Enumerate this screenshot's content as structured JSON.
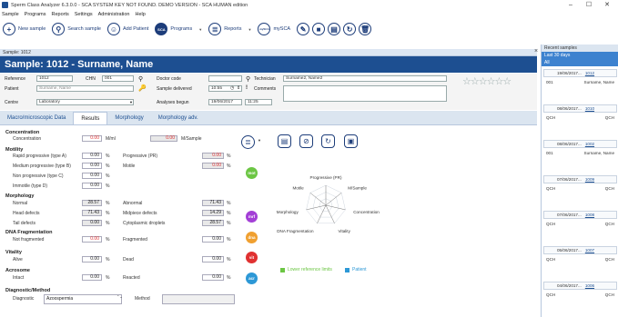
{
  "window": {
    "title": "Sperm Class Analyzer 6.3.0.0 - SCA SYSTEM KEY NOT FOUND. DEMO VERSION - SCA HUMAN edition",
    "minimize": "–",
    "maximize": "☐",
    "close": "✕"
  },
  "menu": [
    "Sample",
    "Programs",
    "Reports",
    "Settings",
    "Administration",
    "Help"
  ],
  "toolbar": {
    "new_sample": "New sample",
    "search_sample": "Search sample",
    "add_patient": "Add Patient",
    "programs": "Programs",
    "reports": "Reports",
    "mysca": "mySCA",
    "sca_badge": "SCA",
    "mysca_badge": "mySCA"
  },
  "sample_tab": "Sample: 1012",
  "header": {
    "title": "Sample: 1012 - Surname, Name"
  },
  "form": {
    "reference_label": "Reference",
    "reference_value": "1012",
    "chn_label": "CHN",
    "chn_value": "001",
    "doctor_label": "Doctor code",
    "doctor_value": "",
    "technician_label": "Technician",
    "technician_value": "Surname2, Name2",
    "patient_label": "Patient",
    "patient_value": "Surname, Name",
    "delivered_label": "Sample delivered",
    "delivered_value": "10:55",
    "comments_label": "Comments",
    "centre_label": "Centre",
    "centre_value": "Laboratory",
    "analyses_label": "Analyses begun",
    "analyses_date": "19/06/2017",
    "analyses_time": "11:25"
  },
  "rating_stars": 0,
  "tabs": [
    "Macro/microscopic Data",
    "Results",
    "Morphology",
    "Morphology adv."
  ],
  "active_tab": "Results",
  "results": {
    "concentration": {
      "title": "Concentration",
      "label": "Concentration",
      "value": "0.00",
      "unit": "M/ml",
      "value2": "0.00",
      "unit2": "M/Sample"
    },
    "motility": {
      "title": "Motility",
      "rows": [
        {
          "label": "Rapid progressive (type A)",
          "value": "0.00",
          "unit": "%"
        },
        {
          "label": "Medium progressive (type B)",
          "value": "0.00",
          "unit": "%"
        },
        {
          "label": "Non progressive (type C)",
          "value": "0.00",
          "unit": "%"
        },
        {
          "label": "Immotile (type D)",
          "value": "0.00",
          "unit": "%"
        }
      ],
      "rows2": [
        {
          "label": "Progressive (PR)",
          "value": "0.00",
          "unit": "%"
        },
        {
          "label": "Motile",
          "value": "0.00",
          "unit": "%"
        }
      ]
    },
    "morphology": {
      "title": "Morphology",
      "rows": [
        {
          "label": "Normal",
          "value": "28.57",
          "unit": "%"
        },
        {
          "label": "Head defects",
          "value": "71.43",
          "unit": "%"
        },
        {
          "label": "Tail defects",
          "value": "0.00",
          "unit": "%"
        }
      ],
      "rows2": [
        {
          "label": "Abnormal",
          "value": "71.43",
          "unit": "%"
        },
        {
          "label": "Midpiece defects",
          "value": "14.29",
          "unit": "%"
        },
        {
          "label": "Cytoplasmic droplets",
          "value": "28.57",
          "unit": "%"
        }
      ]
    },
    "dna": {
      "title": "DNA Fragmentation",
      "label": "Not fragmented",
      "value": "0.00",
      "unit": "%",
      "label2": "Fragmented",
      "value2": "0.00",
      "unit2": "%"
    },
    "vitality": {
      "title": "Vitality",
      "label": "Alive",
      "value": "0.00",
      "unit": "%",
      "label2": "Dead",
      "value2": "0.00",
      "unit2": "%"
    },
    "acrosome": {
      "title": "Acrosome",
      "label": "Intact",
      "value": "0.00",
      "unit": "%",
      "label2": "Reacted",
      "value2": "0.00",
      "unit2": "%"
    },
    "diagnostic": {
      "title": "Diagnostic/Method",
      "label": "Diagnostic",
      "value": "Azoospermia",
      "method_label": "Method"
    }
  },
  "badges": [
    {
      "label": "mot",
      "color": "#6cc644"
    },
    {
      "label": "mrf",
      "color": "#a33fd6"
    },
    {
      "label": "dna",
      "color": "#f0a030"
    },
    {
      "label": "vit",
      "color": "#e03131"
    },
    {
      "label": "acr",
      "color": "#2d98d6"
    }
  ],
  "radar": {
    "labels": [
      "Progressive (PR)",
      "M/Sample",
      "Concentration",
      "Vitality",
      "DNA Fragmentation",
      "Morphology",
      "Motile"
    ],
    "legend_lower": "Lower reference limits",
    "legend_patient": "Patient",
    "lower_color": "#6cc644",
    "patient_color": "#2d98d6"
  },
  "recent": {
    "title": "Recent samples",
    "range": "Last 30 days",
    "filter": "All",
    "items": [
      {
        "date": "19/06/2017...",
        "id": "1012",
        "col1": "001",
        "col2": "Surname, Name"
      },
      {
        "date": "08/06/2017...",
        "id": "1010",
        "col1": "QCH",
        "col2": "QCH"
      },
      {
        "date": "08/06/2017...",
        "id": "1002",
        "col1": "001",
        "col2": "Surname, Name"
      },
      {
        "date": "07/06/2017...",
        "id": "1009",
        "col1": "QCH",
        "col2": "QCH"
      },
      {
        "date": "07/06/2017...",
        "id": "1008",
        "col1": "QCH",
        "col2": "QCH"
      },
      {
        "date": "05/06/2017...",
        "id": "1007",
        "col1": "QCH",
        "col2": "QCH"
      },
      {
        "date": "04/06/2017...",
        "id": "1006",
        "col1": "QCH",
        "col2": "QCH"
      }
    ],
    "close": "×"
  }
}
